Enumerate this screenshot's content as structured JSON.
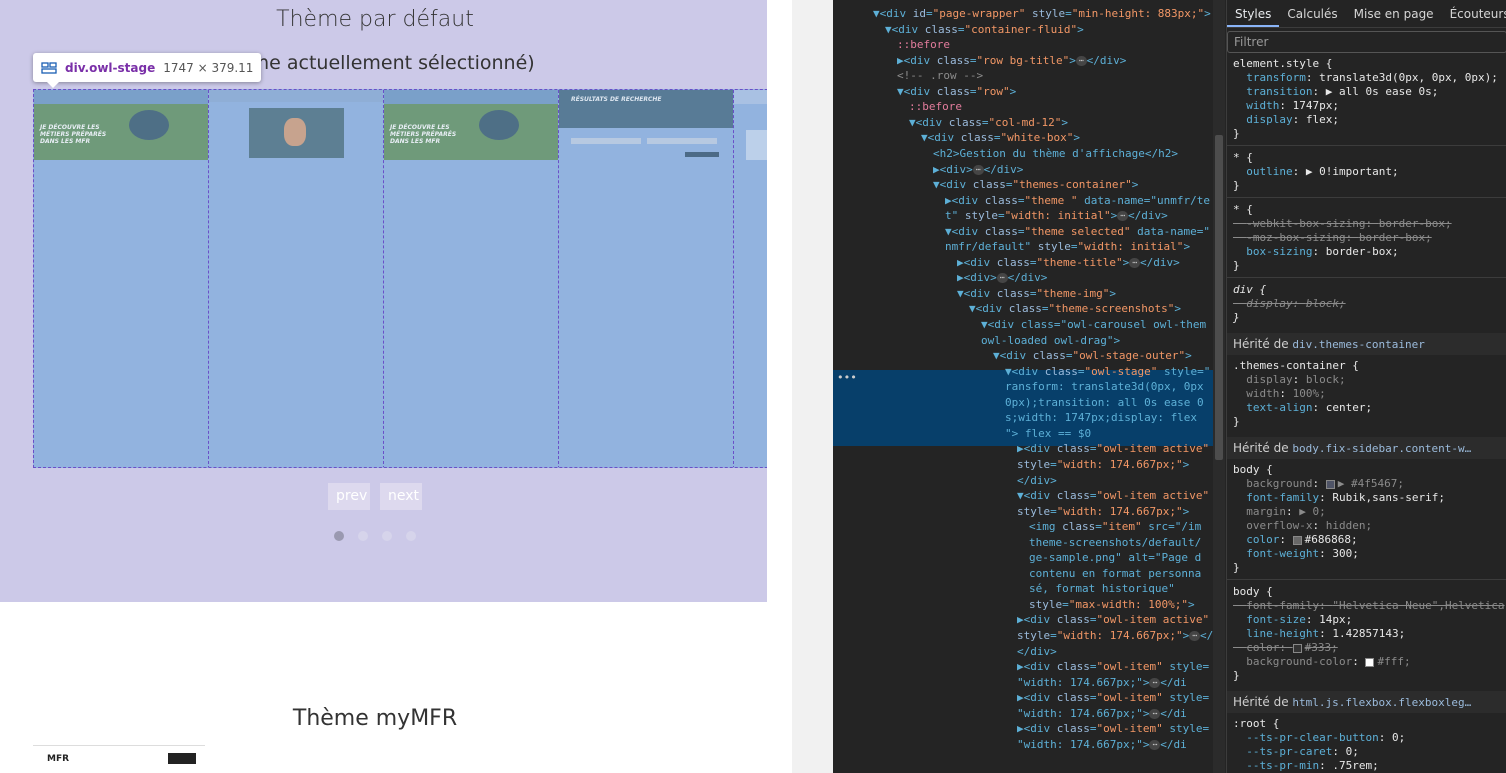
{
  "page": {
    "theme_title": "Thème par défaut",
    "theme_subtitle": "Thème actuellement sélectionné)",
    "tooltip": {
      "name": "div.owl-stage",
      "size": "1747 × 379.11"
    },
    "slides": [
      {
        "kind": "bird",
        "text": "JE DÉCOUVRE LES MÉTIERS PRÉPARÉS DANS LES MFR"
      },
      {
        "kind": "doc",
        "text": ""
      },
      {
        "kind": "bird",
        "text": "JE DÉCOUVRE LES MÉTIERS PRÉPARÉS DANS LES MFR"
      },
      {
        "kind": "form",
        "text": "RÉSULTATS DE RECHERCHE"
      },
      {
        "kind": "list",
        "text": ""
      }
    ],
    "prev_label": "prev",
    "next_label": "next",
    "dots": [
      true,
      false,
      false,
      false
    ],
    "second_title": "Thème myMFR",
    "mfr_logo": "MFR"
  },
  "devtools": {
    "tabs": [
      "Styles",
      "Calculés",
      "Mise en page",
      "Écouteurs"
    ],
    "active_tab": "Styles",
    "filter_placeholder": "Filtrer",
    "elements": [
      {
        "text": "▼<div id=\"page-wrapper\" style=\"min-height: 883px;\">",
        "indent": 0
      },
      {
        "text": "▼<div class=\"container-fluid\">",
        "indent": 1
      },
      {
        "text": "::before",
        "indent": 2,
        "pseudo": true
      },
      {
        "text": "▶<div class=\"row bg-title\">⋯</div>",
        "indent": 2
      },
      {
        "text": "<!-- .row -->",
        "indent": 2,
        "comment": true
      },
      {
        "text": "▼<div class=\"row\">",
        "indent": 2
      },
      {
        "text": "::before",
        "indent": 3,
        "pseudo": true
      },
      {
        "text": "▼<div class=\"col-md-12\">",
        "indent": 3
      },
      {
        "text": "▼<div class=\"white-box\">",
        "indent": 4
      },
      {
        "text": "<h2>Gestion du thème d'affichage</h2>",
        "indent": 5
      },
      {
        "text": "▶<div>⋯</div>",
        "indent": 5
      },
      {
        "text": "▼<div class=\"themes-container\">",
        "indent": 5
      },
      {
        "text": "▶<div class=\"theme \" data-name=\"unmfr/te",
        "indent": 6
      },
      {
        "text": "t\" style=\"width: initial\">⋯</div>",
        "indent": 6
      },
      {
        "text": "▼<div class=\"theme selected\" data-name=\"",
        "indent": 6
      },
      {
        "text": "nmfr/default\" style=\"width: initial\">",
        "indent": 6
      },
      {
        "text": "▶<div class=\"theme-title\">⋯</div>",
        "indent": 7
      },
      {
        "text": "▶<div>⋯</div>",
        "indent": 7
      },
      {
        "text": "▼<div class=\"theme-img\">",
        "indent": 7
      },
      {
        "text": "▼<div class=\"theme-screenshots\">",
        "indent": 8
      },
      {
        "text": "▼<div class=\"owl-carousel owl-them",
        "indent": 9
      },
      {
        "text": "owl-loaded owl-drag\">",
        "indent": 9
      },
      {
        "text": "▼<div class=\"owl-stage-outer\">",
        "indent": 10
      },
      {
        "text": "▼<div class=\"owl-stage\" style=\"",
        "indent": 11,
        "selected": true
      },
      {
        "text": "ransform: translate3d(0px, 0px",
        "indent": 11,
        "selected": true
      },
      {
        "text": "0px);transition: all 0s ease 0",
        "indent": 11,
        "selected": true
      },
      {
        "text": "s;width: 1747px;display: flex",
        "indent": 11,
        "selected": true
      },
      {
        "text": "\"> flex == $0",
        "indent": 11,
        "selected": true
      },
      {
        "text": "▶<div class=\"owl-item active\"",
        "indent": 12
      },
      {
        "text": "style=\"width: 174.667px;\">",
        "indent": 12
      },
      {
        "text": "</div>",
        "indent": 12
      },
      {
        "text": "▼<div class=\"owl-item active\"",
        "indent": 12
      },
      {
        "text": "style=\"width: 174.667px;\">",
        "indent": 12
      },
      {
        "text": "<img class=\"item\" src=\"/im",
        "indent": 13
      },
      {
        "text": "theme-screenshots/default/",
        "indent": 13
      },
      {
        "text": "ge-sample.png\" alt=\"Page d",
        "indent": 13
      },
      {
        "text": "contenu en format personna",
        "indent": 13
      },
      {
        "text": "sé, format historique\"",
        "indent": 13
      },
      {
        "text": "style=\"max-width: 100%;\">",
        "indent": 13
      },
      {
        "text": "▶<div class=\"owl-item active\"",
        "indent": 12
      },
      {
        "text": "style=\"width: 174.667px;\">⋯</",
        "indent": 12
      },
      {
        "text": "</div>",
        "indent": 12
      },
      {
        "text": "▶<div class=\"owl-item\" style=",
        "indent": 12
      },
      {
        "text": "\"width: 174.667px;\">⋯</di",
        "indent": 12
      },
      {
        "text": "▶<div class=\"owl-item\" style=",
        "indent": 12
      },
      {
        "text": "\"width: 174.667px;\">⋯</di",
        "indent": 12
      },
      {
        "text": "▶<div class=\"owl-item\" style=",
        "indent": 12
      },
      {
        "text": "\"width: 174.667px;\">⋯</di",
        "indent": 12
      }
    ],
    "styles": [
      {
        "text": "element.style {",
        "kind": "sel"
      },
      {
        "text": "  transform: translate3d(0px, 0px, 0px);",
        "kind": "prop"
      },
      {
        "text": "  transition: ▶ all 0s ease 0s;",
        "kind": "prop"
      },
      {
        "text": "  width: 1747px;",
        "kind": "prop"
      },
      {
        "text": "  display: flex;",
        "kind": "prop"
      },
      {
        "text": "}",
        "kind": "sel"
      },
      {
        "text": "* {",
        "kind": "sel",
        "gap": true
      },
      {
        "text": "  outline: ▶ 0!important;",
        "kind": "prop"
      },
      {
        "text": "}",
        "kind": "sel"
      },
      {
        "text": "* {",
        "kind": "sel",
        "gap": true
      },
      {
        "text": "  -webkit-box-sizing: border-box;",
        "kind": "strike"
      },
      {
        "text": "  -moz-box-sizing: border-box;",
        "kind": "strike"
      },
      {
        "text": "  box-sizing: border-box;",
        "kind": "prop"
      },
      {
        "text": "}",
        "kind": "sel"
      },
      {
        "text": "div {",
        "kind": "sel",
        "gap": true,
        "italic": true
      },
      {
        "text": "  display: block;",
        "kind": "strike",
        "italic": true
      },
      {
        "text": "}",
        "kind": "sel",
        "italic": true
      }
    ],
    "inherited": [
      {
        "label": "Hérité de ",
        "link": "div.themes-container",
        "rules": [
          {
            "text": ".themes-container {",
            "kind": "sel"
          },
          {
            "text": "  display: block;",
            "kind": "dim"
          },
          {
            "text": "  width: 100%;",
            "kind": "dim"
          },
          {
            "text": "  text-align: center;",
            "kind": "prop"
          },
          {
            "text": "}",
            "kind": "sel"
          }
        ]
      },
      {
        "label": "Hérité de ",
        "link": "body.fix-sidebar.content-w…",
        "rules": [
          {
            "text": "body {",
            "kind": "sel"
          },
          {
            "text": "  background: ▶ #4f5467;",
            "kind": "dim",
            "swatch": "#4f5467"
          },
          {
            "text": "  font-family: Rubik,sans-serif;",
            "kind": "prop"
          },
          {
            "text": "  margin: ▶ 0;",
            "kind": "dim"
          },
          {
            "text": "  overflow-x: hidden;",
            "kind": "dim"
          },
          {
            "text": "  color: #686868;",
            "kind": "prop",
            "swatch": "#686868"
          },
          {
            "text": "  font-weight: 300;",
            "kind": "prop"
          },
          {
            "text": "}",
            "kind": "sel"
          },
          {
            "text": "body {",
            "kind": "sel",
            "gap": true
          },
          {
            "text": "  font-family: \"Helvetica Neue\",Helvetica",
            "kind": "strike"
          },
          {
            "text": "  font-size: 14px;",
            "kind": "prop"
          },
          {
            "text": "  line-height: 1.42857143;",
            "kind": "prop"
          },
          {
            "text": "  color: #333;",
            "kind": "strike",
            "swatch": "#333333"
          },
          {
            "text": "  background-color: #fff;",
            "kind": "dim",
            "swatch": "#ffffff"
          },
          {
            "text": "}",
            "kind": "sel"
          }
        ]
      },
      {
        "label": "Hérité de ",
        "link": "html.js.flexbox.flexboxleg…",
        "rules": [
          {
            "text": ":root {",
            "kind": "sel"
          },
          {
            "text": "  --ts-pr-clear-button: 0;",
            "kind": "prop"
          },
          {
            "text": "  --ts-pr-caret: 0;",
            "kind": "prop"
          },
          {
            "text": "  --ts-pr-min: .75rem;",
            "kind": "prop"
          },
          {
            "text": "}",
            "kind": "sel"
          }
        ]
      }
    ]
  }
}
